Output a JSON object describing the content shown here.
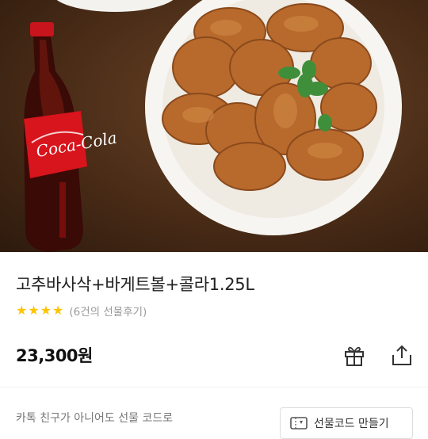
{
  "product": {
    "title": "고추바사삭+바게트볼+콜라1.25L",
    "stars_filled": 4,
    "review_text": "(6건의 선물후기)",
    "price": "23,300원"
  },
  "hero": {
    "bottle_label": "Coca-Cola"
  },
  "actions": {
    "gift_icon": "gift-icon",
    "share_icon": "share-icon"
  },
  "footer": {
    "notice": "카톡 친구가 아니어도 선물 코드로",
    "code_button_label": "선물코드 만들기"
  },
  "colors": {
    "star": "#ffc400",
    "coke_red": "#d8141c"
  }
}
